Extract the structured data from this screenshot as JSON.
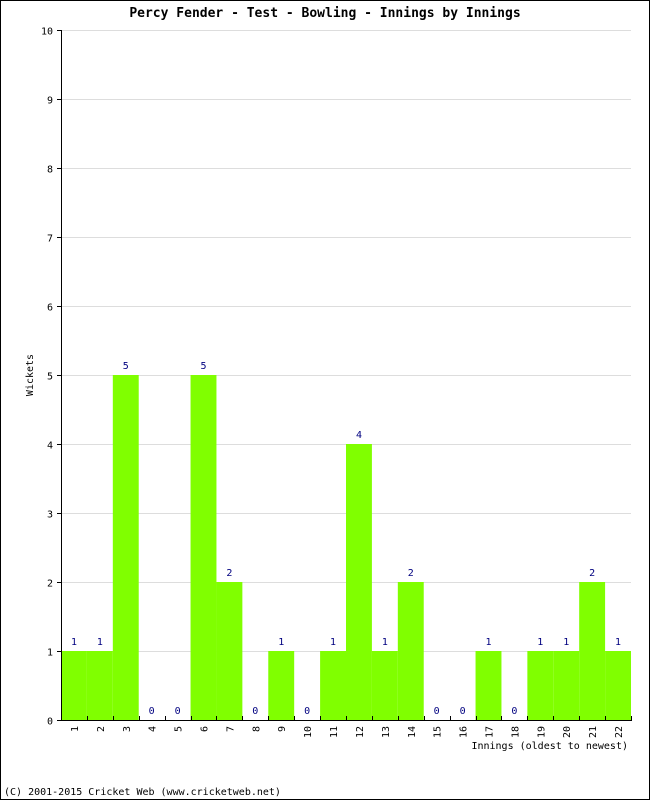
{
  "chart_data": {
    "type": "bar",
    "title": "Percy Fender - Test - Bowling - Innings by Innings",
    "xlabel": "Innings (oldest to newest)",
    "ylabel": "Wickets",
    "ylim": [
      0,
      10
    ],
    "yticks": [
      0,
      1,
      2,
      3,
      4,
      5,
      6,
      7,
      8,
      9,
      10
    ],
    "grid": true,
    "categories": [
      "1",
      "2",
      "3",
      "4",
      "5",
      "6",
      "7",
      "8",
      "9",
      "10",
      "11",
      "12",
      "13",
      "14",
      "15",
      "16",
      "17",
      "18",
      "19",
      "20",
      "21",
      "22"
    ],
    "values": [
      1,
      1,
      5,
      0,
      0,
      5,
      2,
      0,
      1,
      0,
      1,
      4,
      1,
      2,
      0,
      0,
      1,
      0,
      1,
      1,
      2,
      1
    ],
    "bar_color": "#80ff00",
    "label_color": "#000080",
    "gridline_color": "#dddddd"
  },
  "footer": {
    "copyright": "(C) 2001-2015 Cricket Web (www.cricketweb.net)"
  }
}
